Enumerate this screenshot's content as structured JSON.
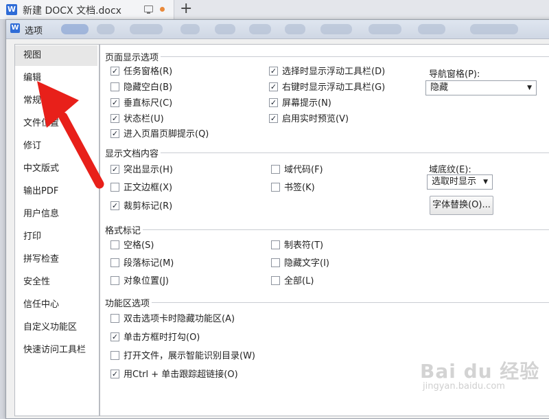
{
  "window": {
    "tab_title": "新建 DOCX 文档.docx",
    "logo_letter": "W",
    "newtab_glyph": "+"
  },
  "dialog": {
    "title": "选项",
    "logo_letter": "W"
  },
  "sidebar": {
    "items": [
      {
        "label": "视图"
      },
      {
        "label": "编辑"
      },
      {
        "label": "常规与保存"
      },
      {
        "label": "文件位置"
      },
      {
        "label": "修订"
      },
      {
        "label": "中文版式"
      },
      {
        "label": "输出PDF"
      },
      {
        "label": "用户信息"
      },
      {
        "label": "打印"
      },
      {
        "label": "拼写检查"
      },
      {
        "label": "安全性"
      },
      {
        "label": "信任中心"
      },
      {
        "label": "自定义功能区"
      },
      {
        "label": "快速访问工具栏"
      }
    ],
    "active_index": 0
  },
  "sections": {
    "page_display": {
      "title": "页面显示选项",
      "options": [
        {
          "label": "任务窗格(R)",
          "checked": true
        },
        {
          "label": "隐藏空白(B)",
          "checked": false
        },
        {
          "label": "垂直标尺(C)",
          "checked": true
        },
        {
          "label": "状态栏(U)",
          "checked": true
        },
        {
          "label": "进入页眉页脚提示(Q)",
          "checked": true
        },
        {
          "label": "选择时显示浮动工具栏(D)",
          "checked": true
        },
        {
          "label": "右键时显示浮动工具栏(G)",
          "checked": true
        },
        {
          "label": "屏幕提示(N)",
          "checked": true
        },
        {
          "label": "启用实时预览(V)",
          "checked": true
        }
      ],
      "nav_label": "导航窗格(P):",
      "nav_value": "隐藏"
    },
    "doc_content": {
      "title": "显示文档内容",
      "options": [
        {
          "label": "突出显示(H)",
          "checked": true
        },
        {
          "label": "正文边框(X)",
          "checked": false
        },
        {
          "label": "裁剪标记(R)",
          "checked": true
        },
        {
          "label": "域代码(F)",
          "checked": false
        },
        {
          "label": "书签(K)",
          "checked": false
        }
      ],
      "shading_label": "域底纹(E):",
      "shading_value": "选取时显示",
      "font_button": "字体替换(O)..."
    },
    "format_marks": {
      "title": "格式标记",
      "options": [
        {
          "label": "空格(S)",
          "checked": false
        },
        {
          "label": "段落标记(M)",
          "checked": false
        },
        {
          "label": "对象位置(J)",
          "checked": false
        },
        {
          "label": "制表符(T)",
          "checked": false
        },
        {
          "label": "隐藏文字(I)",
          "checked": false
        },
        {
          "label": "全部(L)",
          "checked": false
        }
      ]
    },
    "ribbon": {
      "title": "功能区选项",
      "options": [
        {
          "label": "双击选项卡时隐藏功能区(A)",
          "checked": false
        },
        {
          "label": "单击方框时打勾(O)",
          "checked": true
        },
        {
          "label": "打开文件，展示智能识别目录(W)",
          "checked": false
        },
        {
          "label": "用Ctrl + 单击跟踪超链接(O)",
          "checked": true
        }
      ]
    }
  },
  "watermark": {
    "main": "Bai du 经验",
    "sub": "jingyan.baidu.com"
  },
  "colors": {
    "accent_blue": "#2f6cd7",
    "annotation_arrow": "#e8201a",
    "orange_dot": "#e98a3b"
  },
  "icons": {
    "check_glyph": "✓",
    "dropdown_glyph": "▼"
  }
}
